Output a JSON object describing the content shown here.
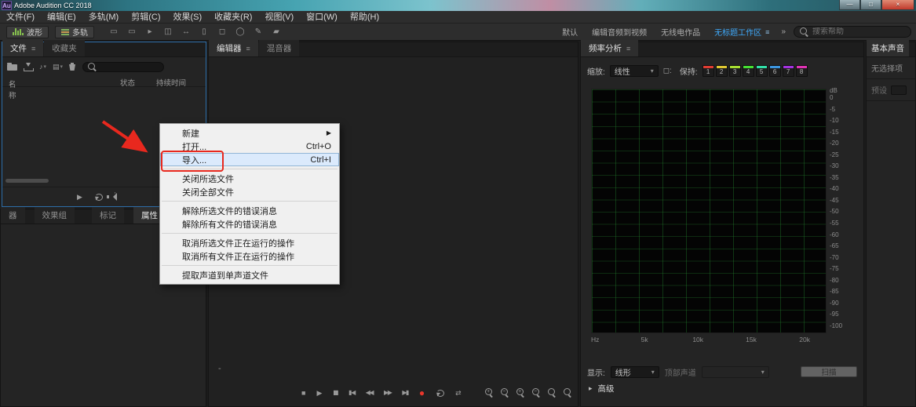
{
  "window": {
    "badge": "Au",
    "title": "Adobe Audition CC 2018",
    "controls": {
      "minimize": "—",
      "maximize": "□",
      "close": "×"
    }
  },
  "icons": {
    "panel_menu": "≡",
    "dropdown": "▾",
    "sort_down": "↓",
    "submenu": "▶",
    "advanced_caret": "▸",
    "overflow": "»",
    "music_note": "♪",
    "film": "▤",
    "snapshot": "◻:"
  },
  "menu_bar": {
    "items": [
      "文件(F)",
      "编辑(E)",
      "多轨(M)",
      "剪辑(C)",
      "效果(S)",
      "收藏夹(R)",
      "视图(V)",
      "窗口(W)",
      "帮助(H)"
    ]
  },
  "toolbar": {
    "waveform_button": "波形",
    "multitrack_button": "多轨",
    "tools": [
      {
        "name": "time-display-toggle",
        "glyph": "▭"
      },
      {
        "name": "video-display-toggle",
        "glyph": "▭"
      },
      {
        "name": "move-tool",
        "glyph": "▸"
      },
      {
        "name": "razor-tool",
        "glyph": "◫"
      },
      {
        "name": "slip-tool",
        "glyph": "↔"
      },
      {
        "name": "time-selection-tool",
        "glyph": "▯"
      },
      {
        "name": "marquee-selection-tool",
        "glyph": "◻"
      },
      {
        "name": "lasso-selection-tool",
        "glyph": "◯"
      },
      {
        "name": "paintbrush-selection-tool",
        "glyph": "✎"
      },
      {
        "name": "spot-healing-brush-tool",
        "glyph": "▰"
      }
    ],
    "workspaces": [
      "默认",
      "编辑音频到视频",
      "无线电作品",
      "无标题工作区"
    ],
    "active_workspace": "无标题工作区",
    "search_placeholder": "搜索帮助"
  },
  "files_panel": {
    "tabs": [
      {
        "label": "文件",
        "active": true
      },
      {
        "label": "收藏夹",
        "active": false
      }
    ],
    "columns": {
      "name": "名称",
      "status": "状态",
      "duration": "持续时间"
    },
    "rows": []
  },
  "lower_left_panel": {
    "tabs": [
      {
        "label": "器",
        "active": false
      },
      {
        "label": "效果组",
        "active": false
      },
      {
        "label": "标记",
        "active": false
      },
      {
        "label": "属性",
        "active": true
      }
    ]
  },
  "editor_panel": {
    "tabs": [
      {
        "label": "编辑器",
        "active": true
      },
      {
        "label": "混音器",
        "active": false
      }
    ],
    "time_display": "-"
  },
  "transport": {
    "buttons": [
      {
        "name": "stop-button",
        "glyph": "■"
      },
      {
        "name": "play-button",
        "glyph": "▶"
      },
      {
        "name": "pause-button",
        "glyph": "▮▮",
        "tight": true
      },
      {
        "name": "skip-to-start-button",
        "glyph": "▮◀",
        "tight": true
      },
      {
        "name": "rewind-button",
        "glyph": "◀◀",
        "tight": true
      },
      {
        "name": "fast-forward-button",
        "glyph": "▶▶",
        "tight": true
      },
      {
        "name": "skip-to-end-button",
        "glyph": "▶▮",
        "tight": true
      },
      {
        "name": "record-button",
        "glyph": "●",
        "record": true
      },
      {
        "name": "loop-playback-button",
        "css": "i-loop"
      },
      {
        "name": "skip-selection-button",
        "glyph": "⇄"
      }
    ],
    "zoom_buttons": [
      {
        "name": "zoom-in-button",
        "sign": "+"
      },
      {
        "name": "zoom-out-button",
        "sign": "−"
      },
      {
        "name": "zoom-in-horizontal-button",
        "sign": "+"
      },
      {
        "name": "zoom-out-horizontal-button",
        "sign": "−"
      },
      {
        "name": "zoom-to-selection-button",
        "sign": ""
      },
      {
        "name": "zoom-reset-button",
        "sign": ""
      }
    ]
  },
  "context_menu": {
    "items": [
      {
        "label": "新建",
        "submenu": true
      },
      {
        "label": "打开...",
        "shortcut": "Ctrl+O"
      },
      {
        "label": "导入...",
        "shortcut": "Ctrl+I",
        "selected": true
      },
      {
        "type": "separator"
      },
      {
        "label": "关闭所选文件"
      },
      {
        "label": "关闭全部文件"
      },
      {
        "type": "separator"
      },
      {
        "label": "解除所选文件的错误消息"
      },
      {
        "label": "解除所有文件的错误消息"
      },
      {
        "type": "separator"
      },
      {
        "label": "取消所选文件正在运行的操作"
      },
      {
        "label": "取消所有文件正在运行的操作"
      },
      {
        "type": "separator"
      },
      {
        "label": "提取声道到单声道文件"
      }
    ]
  },
  "frequency_panel": {
    "title": "频率分析",
    "zoom_label": "缩放:",
    "zoom_value": "线性",
    "hold_label": "保持:",
    "hold_buttons": [
      {
        "label": "1",
        "color": "#e03c32"
      },
      {
        "label": "2",
        "color": "#e0c832"
      },
      {
        "label": "3",
        "color": "#a8e032"
      },
      {
        "label": "4",
        "color": "#46e032"
      },
      {
        "label": "5",
        "color": "#32e0a8"
      },
      {
        "label": "6",
        "color": "#3c96e0"
      },
      {
        "label": "7",
        "color": "#a432e0"
      },
      {
        "label": "8",
        "color": "#e032b4"
      }
    ],
    "display_label": "显示:",
    "display_value": "线形",
    "top_channel_label": "顶部声道",
    "scan_button": "扫描",
    "advanced_label": "高级"
  },
  "essential_sound_panel": {
    "title": "基本声音",
    "no_selection": "无选择项",
    "preset_label": "预设"
  },
  "annotations": {
    "highlight_color": "#e8281e",
    "highlighted_item": "导入..."
  },
  "chart_data": {
    "type": "line",
    "title": "频率分析",
    "xlabel": "Hz",
    "ylabel": "dB",
    "scale": "linear",
    "xlim_hz": [
      0,
      22050
    ],
    "ylim": [
      -100,
      0
    ],
    "x_ticks": [
      {
        "label": "Hz",
        "pos": 0
      },
      {
        "label": "5k",
        "pos": 22.7
      },
      {
        "label": "10k",
        "pos": 45.4
      },
      {
        "label": "15k",
        "pos": 68.0
      },
      {
        "label": "20k",
        "pos": 90.7
      }
    ],
    "y_unit": "dB",
    "y_ticks": [
      "0",
      "-5",
      "-10",
      "-15",
      "-20",
      "-25",
      "-30",
      "-35",
      "-40",
      "-45",
      "-50",
      "-55",
      "-60",
      "-65",
      "-70",
      "-75",
      "-80",
      "-85",
      "-90",
      "-95",
      "-100"
    ],
    "grid": true,
    "series": []
  }
}
